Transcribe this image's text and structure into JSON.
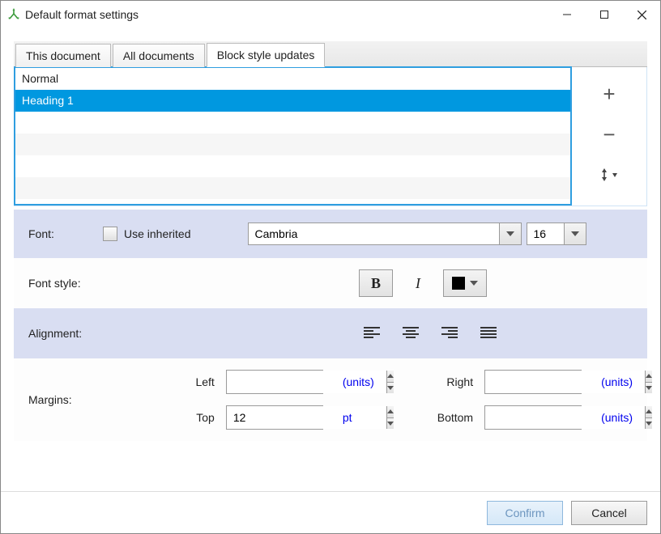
{
  "window": {
    "title": "Default format settings"
  },
  "tabs": {
    "t0": "This document",
    "t1": "All documents",
    "t2": "Block style updates"
  },
  "styles": {
    "s0": "Normal",
    "s1": "Heading 1"
  },
  "icons": {
    "add": "+",
    "remove": "−"
  },
  "font": {
    "label": "Font:",
    "inherit_label": "Use inherited",
    "name": "Cambria",
    "size": "16"
  },
  "fontstyle": {
    "label": "Font style:",
    "bold": "B",
    "italic": "I"
  },
  "alignment": {
    "label": "Alignment:"
  },
  "margins": {
    "label": "Margins:",
    "left_label": "Left",
    "left_value": "",
    "left_units": "(units)",
    "right_label": "Right",
    "right_value": "",
    "right_units": "(units)",
    "top_label": "Top",
    "top_value": "12",
    "top_units": "pt",
    "bottom_label": "Bottom",
    "bottom_value": "",
    "bottom_units": "(units)"
  },
  "footer": {
    "confirm": "Confirm",
    "cancel": "Cancel"
  }
}
